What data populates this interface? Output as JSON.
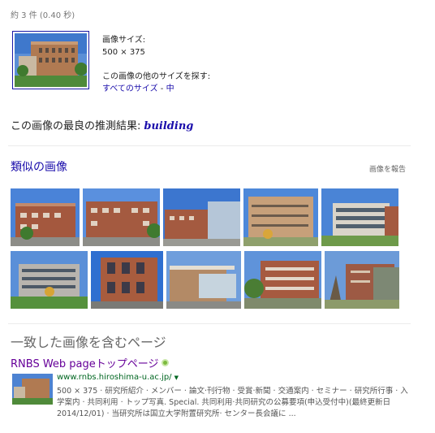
{
  "stats": "約 3 件 (0.40 秒)",
  "query": {
    "size_label": "画像サイズ:",
    "size_value": "500 × 375",
    "other_sizes_label": "この画像の他のサイズを探す:",
    "all_sizes_link": "すべてのサイズ",
    "separator": " - ",
    "medium_link": "中"
  },
  "best_guess": {
    "label": "この画像の最良の推測結果:",
    "query": "building"
  },
  "similar": {
    "title": "類似の画像",
    "report": "画像を報告"
  },
  "pages": {
    "title": "一致した画像を含むページ",
    "result": {
      "title": "RNBS Web pageトップページ",
      "url": "www.rnbs.hiroshima-u.ac.jp/",
      "caret": "▼",
      "snippet": "500 × 375 · 研究所紹介 · メンバー · 論文·刊行物 · 受賞·新聞 · 交通案内 · セミナー · 研究所行事 · 入学案内 · 共同利用 · トップ写真. Special. 共同利用·共同研究の公募要項(申込受付中)(最終更新日2014/12/01) · 当研究所は国立大学附置研究所· センター長会議に ..."
    }
  },
  "colors": {
    "link": "#1a0dab",
    "visited": "#660099",
    "url_green": "#006621",
    "brick": "#a4583e"
  },
  "thumbnails": {
    "row1": [
      "building-photo-1",
      "building-photo-2",
      "building-photo-3",
      "building-photo-4",
      "building-photo-5"
    ],
    "row2": [
      "building-photo-6",
      "building-photo-7",
      "building-photo-8",
      "building-photo-9",
      "building-photo-10"
    ]
  }
}
